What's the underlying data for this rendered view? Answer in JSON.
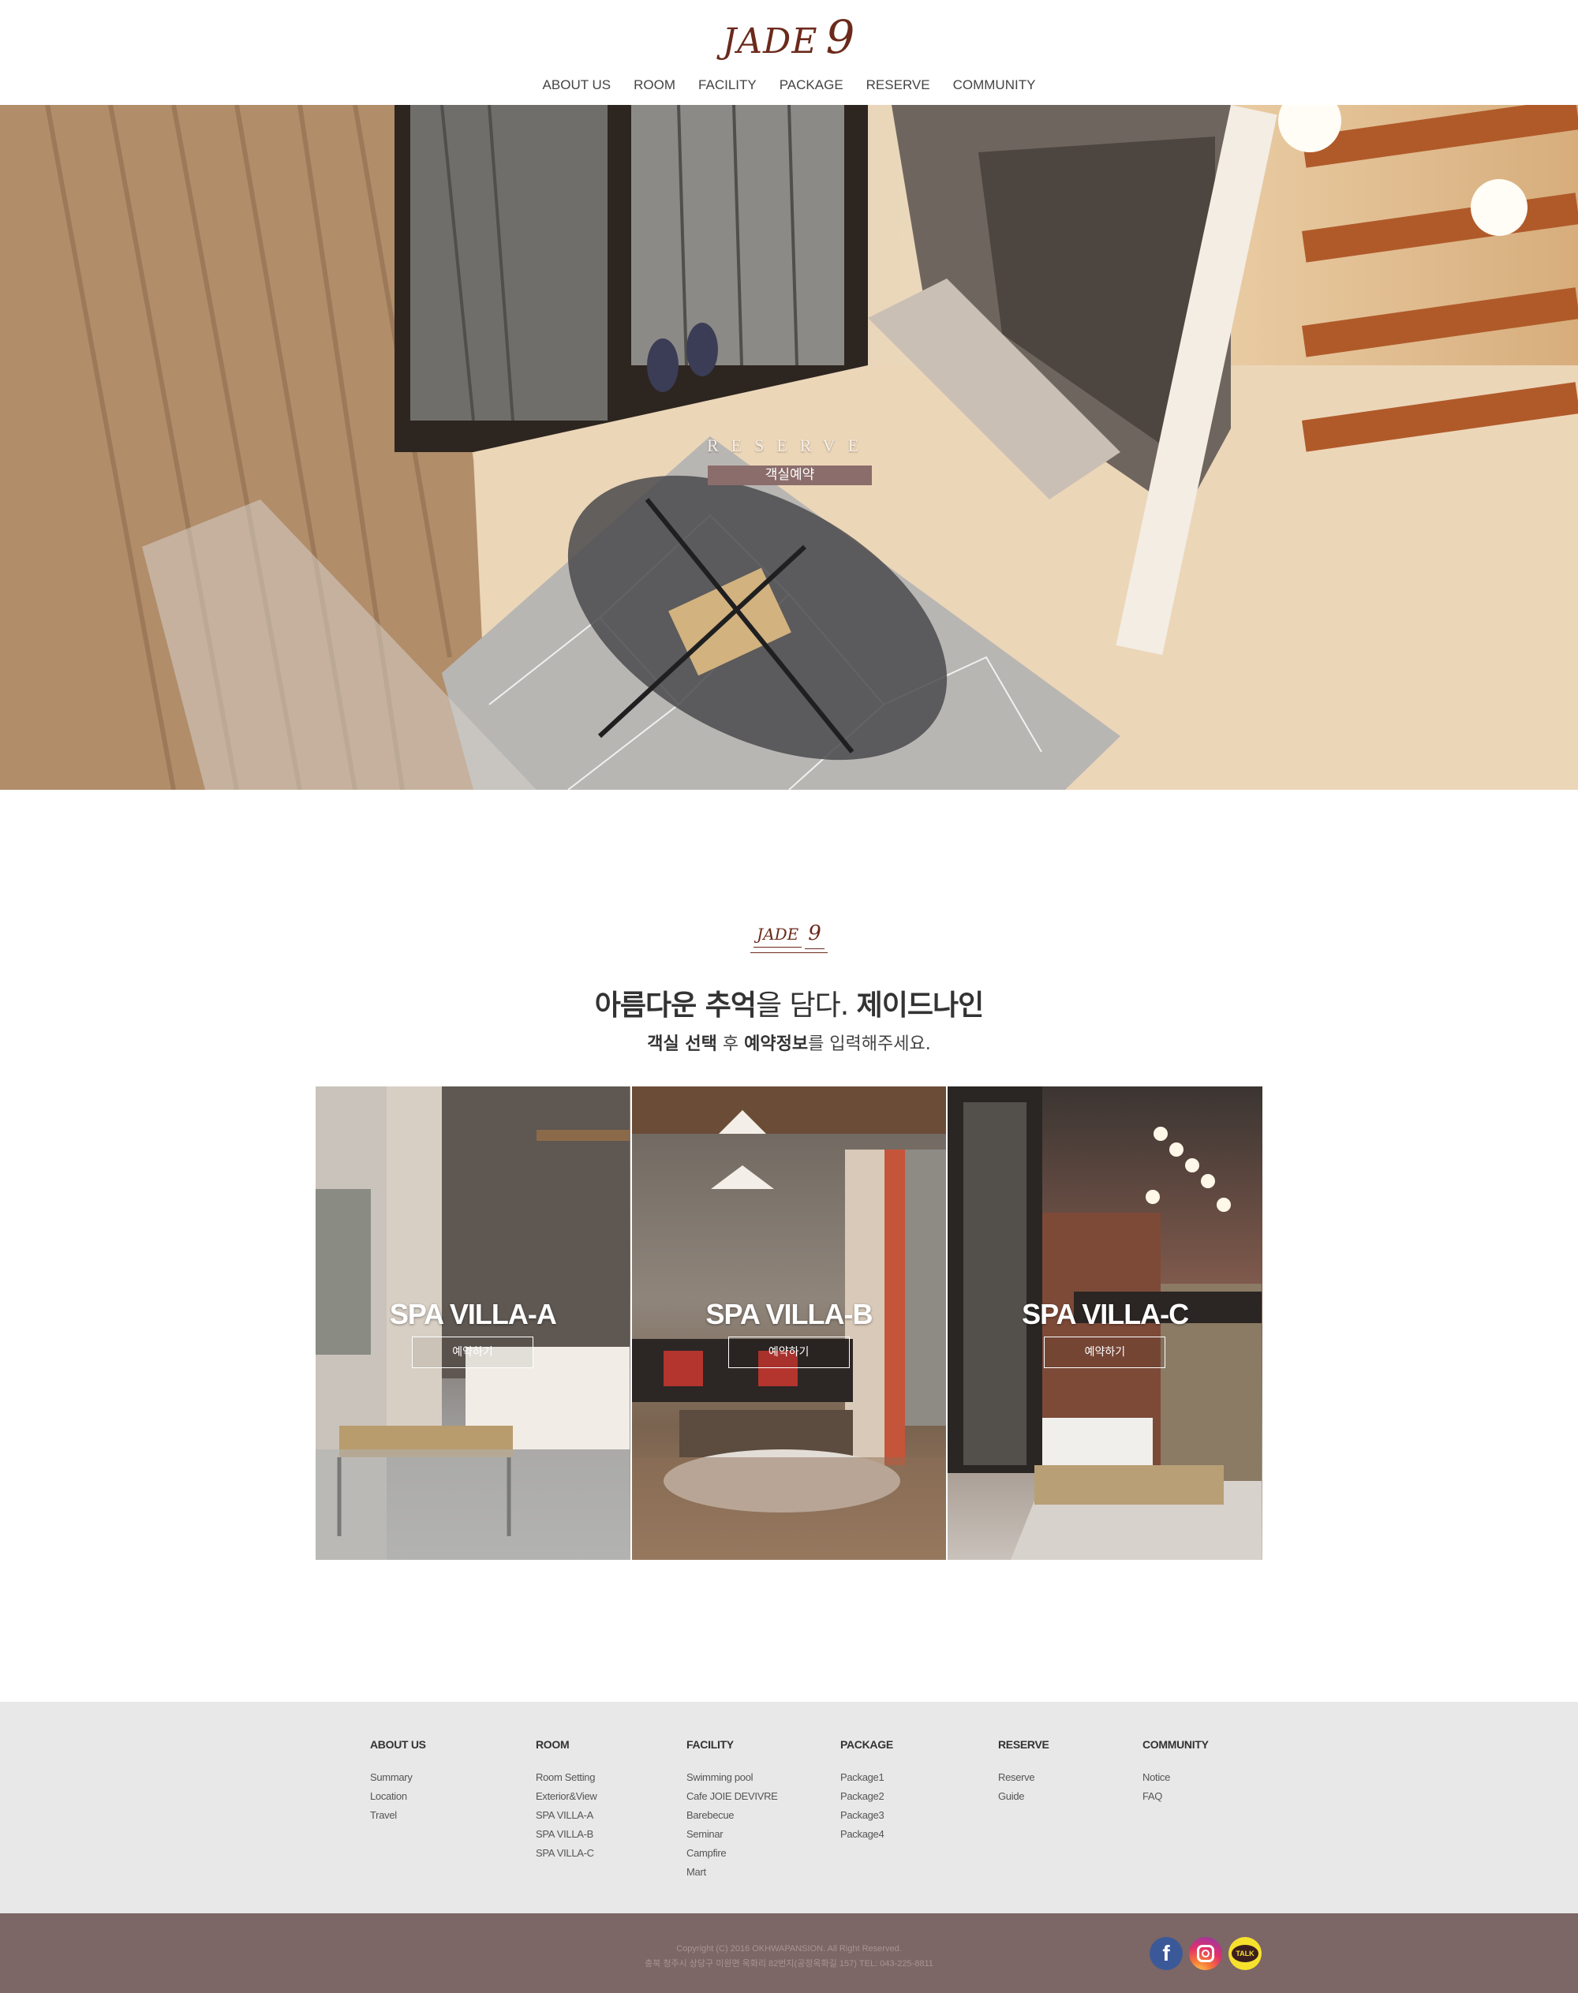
{
  "header": {
    "logo_text": "JADE",
    "logo_num": "9",
    "nav": [
      "ABOUT US",
      "ROOM",
      "FACILITY",
      "PACKAGE",
      "RESERVE",
      "COMMUNITY"
    ]
  },
  "hero": {
    "label": "RESERVE",
    "button": "객실예약"
  },
  "intro": {
    "badge_text": "JADE",
    "badge_num": "9",
    "headline_a": "아름다운 추억",
    "headline_b": "을 담다. ",
    "headline_c": "제이드나인",
    "sub_a": "객실 선택",
    "sub_b": " 후 ",
    "sub_c": "예약정보",
    "sub_d": "를 입력해주세요."
  },
  "rooms": [
    {
      "name": "SPA VILLA-A",
      "button": "예약하기"
    },
    {
      "name": "SPA VILLA-B",
      "button": "예약하기"
    },
    {
      "name": "SPA VILLA-C",
      "button": "예약하기"
    }
  ],
  "footer": {
    "columns": [
      {
        "title": "ABOUT US",
        "items": [
          "Summary",
          "Location",
          "Travel"
        ]
      },
      {
        "title": "ROOM",
        "items": [
          "Room Setting",
          "Exterior&View",
          "SPA VILLA-A",
          "SPA VILLA-B",
          "SPA VILLA-C"
        ]
      },
      {
        "title": "FACILITY",
        "items": [
          "Swimming pool",
          "Cafe JOIE DEVIVRE",
          "Barebecue",
          "Seminar",
          "Campfire",
          "Mart"
        ]
      },
      {
        "title": "PACKAGE",
        "items": [
          "Package1",
          "Package2",
          "Package3",
          "Package4"
        ]
      },
      {
        "title": "RESERVE",
        "items": [
          "Reserve",
          "Guide"
        ]
      },
      {
        "title": "COMMUNITY",
        "items": [
          "Notice",
          "FAQ"
        ]
      }
    ],
    "copyright": "Copyright (C) 2016 OKHWAPANSION. All Right Reserved.",
    "address": "충북 청주시 상당구 미원면 옥화리 82번지(공정옥화길 157) TEL: 043-225-8811",
    "social": {
      "facebook": "f",
      "kakao": "TALK"
    }
  },
  "colors": {
    "brand": "#6b2a1c",
    "hero_button": "#8b6d6b",
    "footer_bottom": "#7c6666",
    "footer_bg": "#e8e8e8"
  }
}
